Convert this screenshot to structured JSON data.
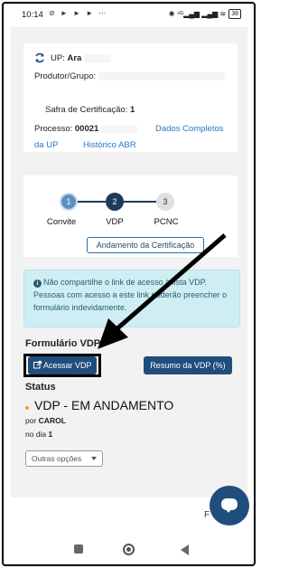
{
  "status_bar": {
    "time": "10:14",
    "notif_icons": "⊘ ► ► ► ⋯",
    "sys_icons": "✱ ⁴ᴳ▂▄▆ ▂▄▆ ≋",
    "battery": "38"
  },
  "header_card": {
    "up_label": "UP:",
    "up_value": "Ara",
    "produtor_label": "Produtor/Grupo:",
    "safra_label": "Safra de Certificação:",
    "safra_value": "1",
    "processo_label": "Processo:",
    "processo_value": "00021",
    "dados_link": "Dados Completos",
    "da_up_link": "da UP",
    "historico_link": "Histórico ABR"
  },
  "stepper": {
    "steps": [
      {
        "number": "1",
        "label": "Convite"
      },
      {
        "number": "2",
        "label": "VDP"
      },
      {
        "number": "3",
        "label": "PCNC"
      }
    ],
    "andamento_button": "Andamento da Certificação"
  },
  "alert": {
    "icon": "i",
    "text": "Não compartilhe o link de acesso à lista VDP. Pessoas com acesso a este link poderão preencher o formulário indevidamente."
  },
  "formulario": {
    "title": "Formulário VDP",
    "acessar_button": "Acessar VDP",
    "resumo_button": "Resumo da VDP (%)"
  },
  "status": {
    "title": "Status",
    "main": "VDP - EM ANDAMENTO",
    "por_label": "por",
    "por_value": "CAROL",
    "dia_label": "no dia",
    "dia_value": "1",
    "outras_opcoes": "Outras opções"
  },
  "footer": {
    "partial_text": "F"
  },
  "colors": {
    "primary": "#1f4e7c",
    "link": "#2a78c2",
    "alert_bg": "#cfeef3",
    "status_dot": "#f0a41c"
  }
}
